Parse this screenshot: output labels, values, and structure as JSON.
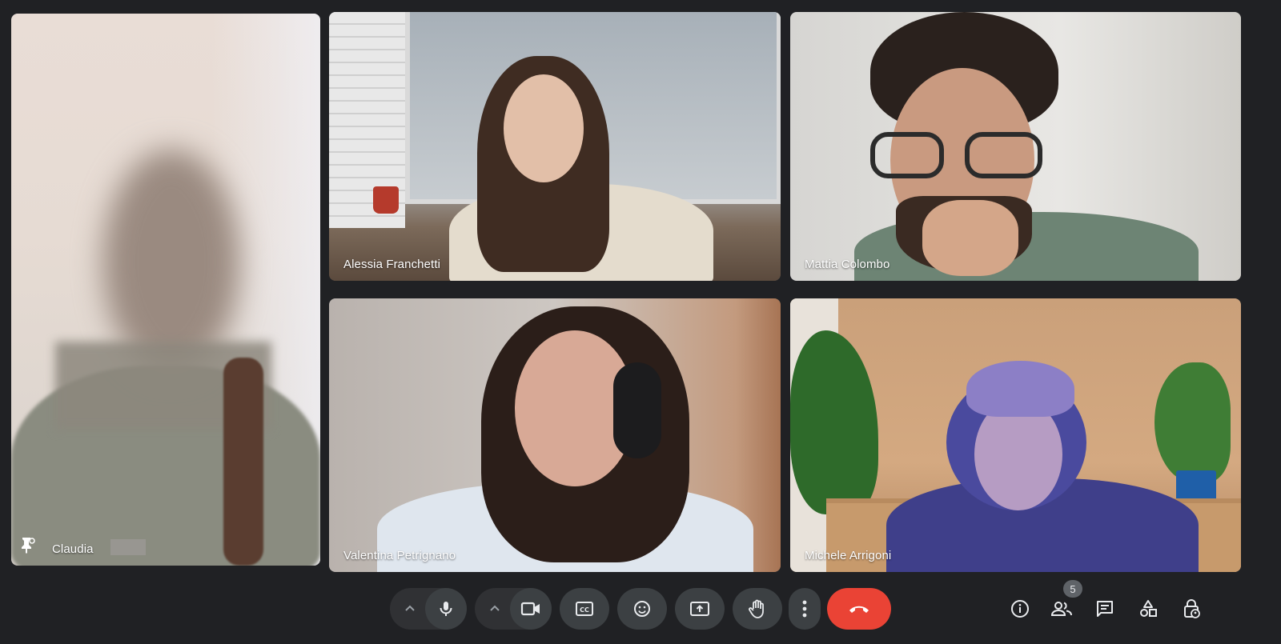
{
  "participants": [
    {
      "name": "Claudia",
      "pinned": true
    },
    {
      "name": "Alessia Franchetti"
    },
    {
      "name": "Mattia Colombo"
    },
    {
      "name": "Valentina Petrignano"
    },
    {
      "name": "Michele Arrigoni"
    }
  ],
  "controls": {
    "mic": "microphone-icon",
    "camera": "camera-icon",
    "captions": "captions-icon",
    "reactions": "emoji-icon",
    "present": "present-screen-icon",
    "raise_hand": "raise-hand-icon",
    "more": "more-options-icon",
    "leave": "end-call-icon",
    "leave_color": "#ea4335"
  },
  "side_panel": {
    "people_count": "5"
  }
}
